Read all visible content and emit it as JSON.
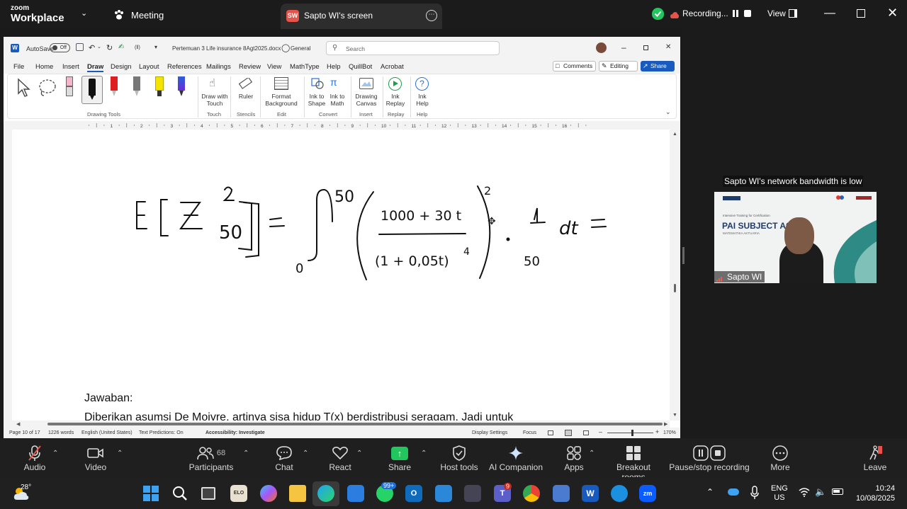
{
  "zoom": {
    "brand_top": "zoom",
    "brand_bottom": "Workplace",
    "meeting_label": "Meeting",
    "share_initials": "SW",
    "share_title": "Sapto WI's screen",
    "recording_label": "Recording...",
    "view_label": "View",
    "bandwidth_notice": "Sapto WI's network bandwidth is low",
    "participant_name": "Sapto WI",
    "video_slide_title": "PAI SUBJECT A60",
    "video_slide_subtitle": "MATEMATIKA AKTUARIA",
    "video_slide_small": "Intensive Training for Certification"
  },
  "word": {
    "autosave_label": "AutoSave",
    "autosave_state": "Off",
    "undo_count": "(ll)",
    "doc_title": "Pertemuan 3 Life insurance 8Agt2025.docx",
    "sensitivity": "General",
    "search_placeholder": "Search",
    "menu": [
      "File",
      "Home",
      "Insert",
      "Draw",
      "Design",
      "Layout",
      "References",
      "Mailings",
      "Review",
      "View",
      "MathType",
      "Help",
      "QuillBot",
      "Acrobat"
    ],
    "comments_label": "Comments",
    "editing_label": "Editing",
    "share_label": "Share",
    "ribbon": {
      "draw_with_touch": "Draw with Touch",
      "ruler": "Ruler",
      "format_background": "Format Background",
      "ink_to_shape": "Ink to Shape",
      "ink_to_math": "Ink to Math",
      "drawing_canvas": "Drawing Canvas",
      "ink_replay": "Ink Replay",
      "ink_help": "Ink Help",
      "groups": [
        "Drawing Tools",
        "Touch",
        "Stencils",
        "Edit",
        "Convert",
        "Insert",
        "Replay",
        "Help"
      ]
    },
    "ruler_numbers": [
      "1",
      "2",
      "3",
      "4",
      "5",
      "6",
      "7",
      "8",
      "9",
      "10",
      "11",
      "12",
      "13",
      "14",
      "15",
      "16"
    ],
    "doc_text_jawaban": "Jawaban:",
    "doc_text_line": "Diberikan asumsi De Moivre, artinya  sisa hidup T(x) berdistribusi seragam. Jadi untuk",
    "status": {
      "page": "Page 10 of 17",
      "words": "1226 words",
      "language": "English (United States)",
      "predictions": "Text Predictions: On",
      "accessibility": "Accessibility: Investigate",
      "display": "Display Settings",
      "focus": "Focus",
      "zoom": "170%"
    }
  },
  "meeting_bar": {
    "audio": "Audio",
    "video": "Video",
    "participants": "Participants",
    "participants_count": "68",
    "chat": "Chat",
    "react": "React",
    "share": "Share",
    "host_tools": "Host tools",
    "ai_companion": "AI Companion",
    "apps": "Apps",
    "breakout": "Breakout rooms",
    "pause_recording": "Pause/stop recording",
    "more": "More",
    "leave": "Leave"
  },
  "taskbar": {
    "temperature": "28°",
    "whatsapp_badge": "99+",
    "teams_badge": "9",
    "lang_top": "ENG",
    "lang_bottom": "US",
    "time": "10:24",
    "date": "10/08/2025"
  },
  "colors": {
    "accent_blue": "#185abd",
    "recording_green": "#22c55e",
    "share_green": "#22c55e",
    "zoom_blue": "#0b5cff"
  }
}
